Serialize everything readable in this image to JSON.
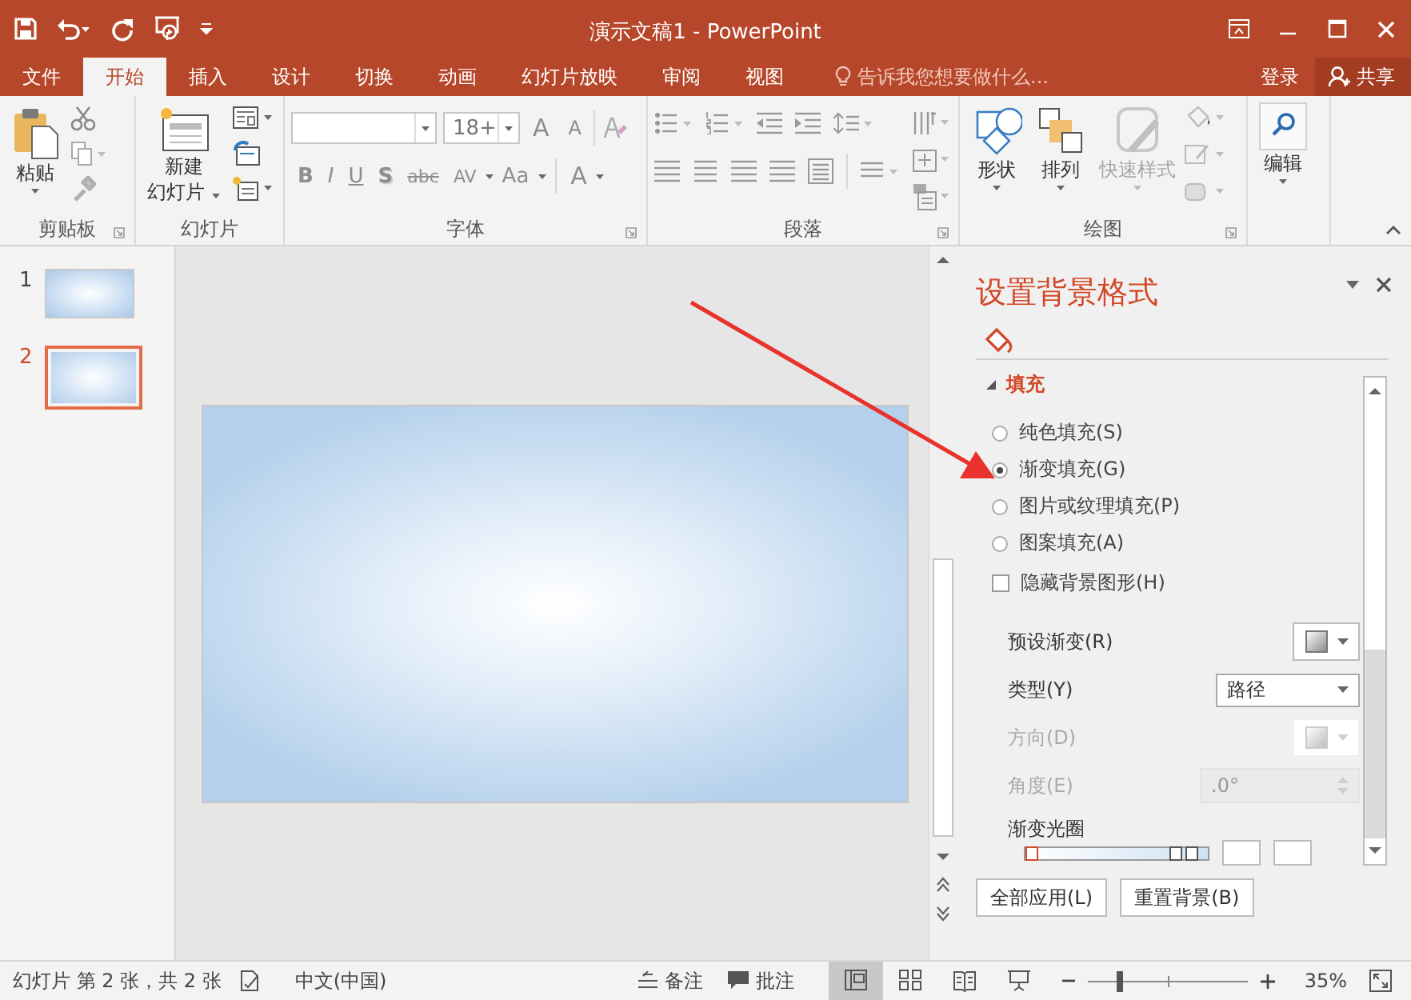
{
  "window": {
    "title": "演示文稿1 - PowerPoint"
  },
  "menu_tabs": [
    {
      "label": "文件",
      "selected": false
    },
    {
      "label": "开始",
      "selected": true
    },
    {
      "label": "插入",
      "selected": false
    },
    {
      "label": "设计",
      "selected": false
    },
    {
      "label": "切换",
      "selected": false
    },
    {
      "label": "动画",
      "selected": false
    },
    {
      "label": "幻灯片放映",
      "selected": false
    },
    {
      "label": "审阅",
      "selected": false
    },
    {
      "label": "视图",
      "selected": false
    }
  ],
  "tell_me": {
    "placeholder": "告诉我您想要做什么..."
  },
  "account": {
    "sign_in": "登录",
    "share": "共享"
  },
  "ribbon": {
    "clipboard": {
      "label": "剪贴板",
      "paste": "粘贴"
    },
    "slides": {
      "label": "幻灯片",
      "new_slide": [
        "新建",
        "幻灯片"
      ]
    },
    "font": {
      "label": "字体",
      "font_size": "18+",
      "size_buttons": [
        "A",
        "A"
      ],
      "format_buttons": [
        "B",
        "I",
        "U",
        "S",
        "abc",
        "AV",
        "Aa"
      ],
      "font_color": "A"
    },
    "paragraph": {
      "label": "段落"
    },
    "drawing": {
      "label": "绘图",
      "buttons": [
        {
          "label": "形状",
          "disabled": false
        },
        {
          "label": "排列",
          "disabled": false
        },
        {
          "label": "快速样式",
          "disabled": true
        }
      ]
    },
    "editing": {
      "label": "编辑"
    }
  },
  "slides": [
    {
      "number": "1",
      "selected": false
    },
    {
      "number": "2",
      "selected": true
    }
  ],
  "format_pane": {
    "title": "设置背景格式",
    "section": {
      "label": "填充",
      "expanded": true
    },
    "fill_options": [
      {
        "kind": "radio",
        "label": "纯色填充(S)",
        "selected": false
      },
      {
        "kind": "radio",
        "label": "渐变填充(G)",
        "selected": true
      },
      {
        "kind": "radio",
        "label": "图片或纹理填充(P)",
        "selected": false
      },
      {
        "kind": "radio",
        "label": "图案填充(A)",
        "selected": false
      },
      {
        "kind": "checkbox",
        "label": "隐藏背景图形(H)",
        "checked": false
      }
    ],
    "settings": [
      {
        "kind": "swatch",
        "label": "预设渐变(R)",
        "disabled": false
      },
      {
        "kind": "dropdown",
        "label": "类型(Y)",
        "value": "路径",
        "disabled": false
      },
      {
        "kind": "swatch",
        "label": "方向(D)",
        "disabled": true
      },
      {
        "kind": "spinner",
        "label": "角度(E)",
        "value": ".0°",
        "disabled": true
      },
      {
        "kind": "stops",
        "label": "渐变光圈",
        "stops": [
          {
            "level": 0,
            "selected": true
          },
          {
            "level": 0.83,
            "selected": false
          },
          {
            "level": 0.93,
            "selected": false
          }
        ]
      }
    ],
    "buttons": [
      "全部应用(L)",
      "重置背景(B)"
    ]
  },
  "status_bar": {
    "slide_info": "幻灯片 第 2 张，共 2 张",
    "language": "中文(中国)",
    "notes": "备注",
    "comments": "批注",
    "views": [
      {
        "kind": "normal",
        "selected": true
      },
      {
        "kind": "sorter",
        "selected": false
      },
      {
        "kind": "reading",
        "selected": false
      },
      {
        "kind": "slideshow",
        "selected": false
      }
    ],
    "zoom": {
      "level": 0.2,
      "reading": "35%"
    }
  }
}
